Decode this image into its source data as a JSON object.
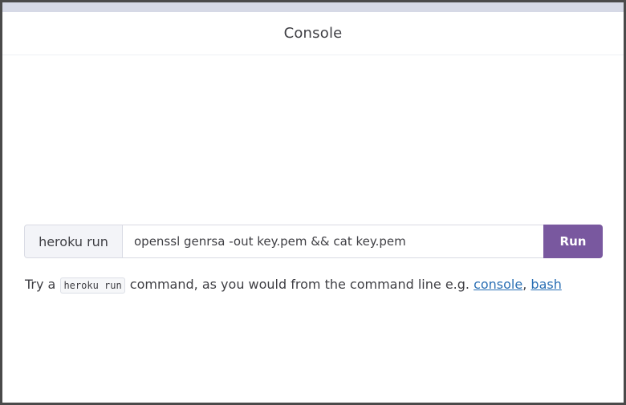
{
  "header": {
    "title": "Console"
  },
  "run_bar": {
    "prefix": "heroku run",
    "command_value": "openssl genrsa -out key.pem && cat key.pem",
    "run_label": "Run"
  },
  "hint": {
    "before": "Try a",
    "code": "heroku run",
    "after": "command, as you would from the command line e.g.",
    "link_console": "console",
    "separator": ",",
    "link_bash": "bash"
  },
  "colors": {
    "accent": "#79589f",
    "link": "#2a6fb4",
    "text": "#3f3f44"
  }
}
